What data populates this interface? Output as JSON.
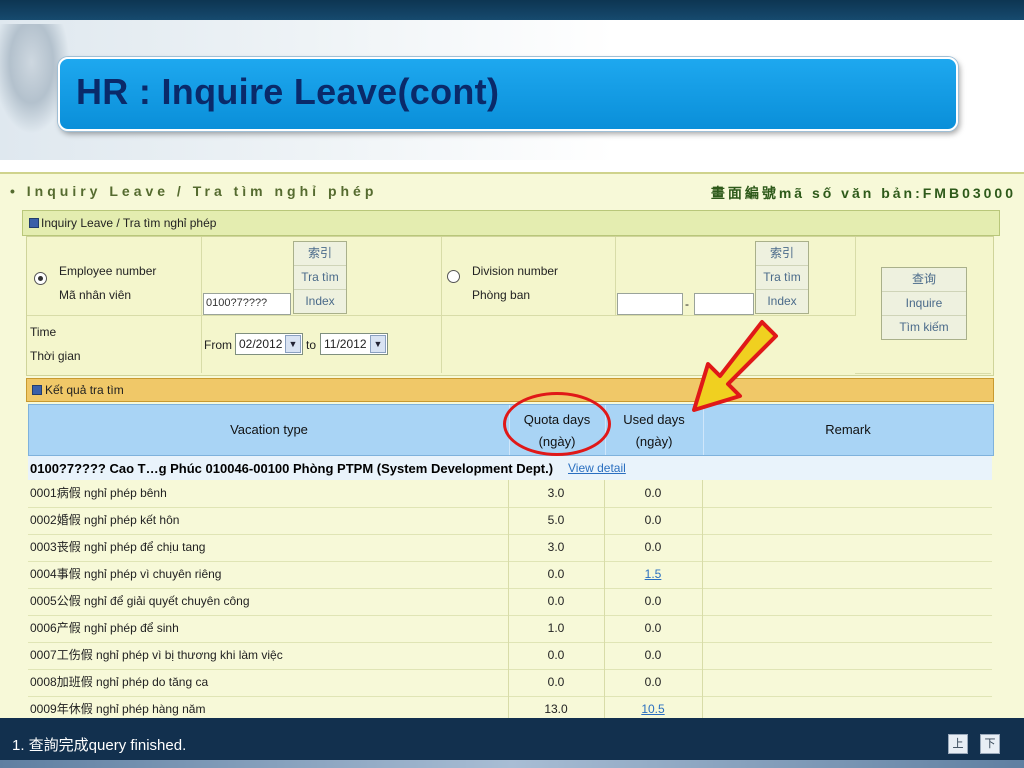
{
  "slide": {
    "title": "HR : Inquire Leave(cont)"
  },
  "breadcrumb": {
    "left": "• Inquiry Leave / Tra tìm nghỉ phép",
    "right": "畫面編號mã số văn bản:FMB03000"
  },
  "panel": {
    "title": "Inquiry Leave / Tra tìm nghỉ phép"
  },
  "form": {
    "employee_label_en": "Employee number",
    "employee_label_vi": "Mã nhân viên",
    "employee_value": "0100?7????",
    "index_buttons": [
      "索引",
      "Tra tìm",
      "Index"
    ],
    "division_label_en": "Division number",
    "division_label_vi": "Phòng ban",
    "division_sep": "-",
    "inquire_buttons": [
      "查询",
      "Inquire",
      "Tìm kiếm"
    ],
    "time_label_en": "Time",
    "time_label_vi": "Thời gian",
    "from_label": "From",
    "from_value": "02/2012",
    "to_label": "to",
    "to_value": "11/2012"
  },
  "results": {
    "title": "Kết quả tra tìm",
    "columns": {
      "vacation_type": "Vacation type",
      "quota_en": "Quota days",
      "quota_vi": "(ngày)",
      "used_en": "Used days",
      "used_vi": "(ngày)",
      "remark": "Remark"
    },
    "employee_row": {
      "text": "0100?7???? Cao T…g Phúc 010046-00100 Phòng PTPM (System Development Dept.)",
      "link": "View detail"
    },
    "rows": [
      {
        "type": "0001病假 nghỉ phép bênh",
        "quota": "3.0",
        "used": "0.0",
        "used_link": false
      },
      {
        "type": "0002婚假 nghỉ phép kết hôn",
        "quota": "5.0",
        "used": "0.0",
        "used_link": false
      },
      {
        "type": "0003丧假 nghỉ phép để chịu tang",
        "quota": "3.0",
        "used": "0.0",
        "used_link": false
      },
      {
        "type": "0004事假 nghỉ phép vì chuyên riêng",
        "quota": "0.0",
        "used": "1.5",
        "used_link": true
      },
      {
        "type": "0005公假 nghỉ để giải quyết chuyên công",
        "quota": "0.0",
        "used": "0.0",
        "used_link": false
      },
      {
        "type": "0006产假 nghỉ phép để sinh",
        "quota": "1.0",
        "used": "0.0",
        "used_link": false
      },
      {
        "type": "0007工伤假 nghỉ phép vì bị thương khi làm việc",
        "quota": "0.0",
        "used": "0.0",
        "used_link": false
      },
      {
        "type": "0008加班假 nghỉ phép do tăng ca",
        "quota": "0.0",
        "used": "0.0",
        "used_link": false
      },
      {
        "type": "0009年休假 nghỉ phép hàng năm",
        "quota": "13.0",
        "used": "10.5",
        "used_link": true
      }
    ]
  },
  "status": {
    "text": "1. 查詢完成query finished.",
    "prev": "上",
    "next": "下"
  },
  "colors": {
    "annotation": "#e01818",
    "arrow_fill": "#f0d020"
  }
}
